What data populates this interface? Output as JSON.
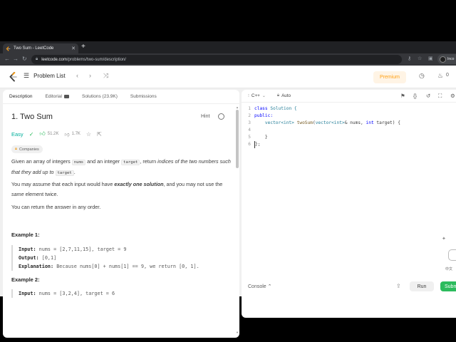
{
  "browser": {
    "tab_title": "Two Sum - LeetCode",
    "url_domain": "leetcode.com",
    "url_path": "/problems/two-sum/description/",
    "profile_label": "Inco"
  },
  "header": {
    "problem_list": "Problem List",
    "premium": "Premium",
    "points": "0"
  },
  "left": {
    "tabs": [
      "Description",
      "Editorial",
      "Solutions (23.9K)",
      "Submissions"
    ],
    "title": "1. Two Sum",
    "hint": "Hint",
    "difficulty": "Easy",
    "likes": "51.2K",
    "dislikes": "1.7K",
    "companies": "Companies",
    "p1": {
      "a": "Given an array of integers ",
      "c1": "nums",
      "b": " and an integer ",
      "c2": "target",
      "d": ", return ",
      "e": "indices of the two numbers such that they add up to",
      "f": " ",
      "c3": "target",
      "g": "."
    },
    "p2": {
      "a": "You may assume that each input would have ",
      "b": "exactly one solution",
      "c": ", and you may not use the ",
      "d": "same",
      "e": " element twice."
    },
    "p3": "You can return the answer in any order.",
    "example1": {
      "title": "Example 1:",
      "input_label": "Input:",
      "input": " nums = [2,7,11,15], target = 9",
      "output_label": "Output:",
      "output": " [0,1]",
      "expl_label": "Explanation:",
      "expl": " Because nums[0] + nums[1] == 9, we return [0, 1]."
    },
    "example2": {
      "title": "Example 2:",
      "input_label": "Input:",
      "input": " nums = [3,2,4], target = 6"
    }
  },
  "editor": {
    "language": "C++",
    "mode": "Auto",
    "lines": [
      {
        "n": "1"
      },
      {
        "n": "2"
      },
      {
        "n": "3"
      },
      {
        "n": "4"
      },
      {
        "n": "5"
      },
      {
        "n": "6"
      }
    ],
    "code": {
      "l1_kw": "class",
      "l1_name": " Solution {",
      "l2": "public:",
      "l3_indent": "    ",
      "l3_type": "vector<int>",
      "l3_fn": " twoSum",
      "l3_rest_a": "(",
      "l3_type2": "vector<int>",
      "l3_rest_b": "& nums, ",
      "l3_kw": "int",
      "l3_rest_c": " target) {",
      "l4": "        ",
      "l5": "    }",
      "l6": "};"
    }
  },
  "console": {
    "label": "Console",
    "run": "Run",
    "submit": "Submit"
  },
  "side": {
    "lang_text": "中文"
  },
  "colors": {
    "accent_green": "#2cbb5d",
    "easy": "#00af9b",
    "premium": "#ffa116"
  }
}
